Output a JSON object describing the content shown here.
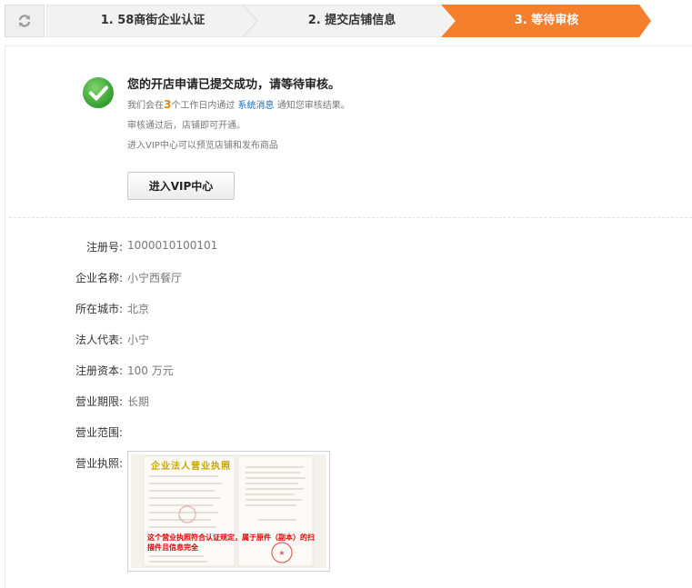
{
  "steps": [
    {
      "label": "1. 58商街企业认证",
      "active": false
    },
    {
      "label": "2. 提交店铺信息",
      "active": false
    },
    {
      "label": "3. 等待审核",
      "active": true
    }
  ],
  "colors": {
    "active_step": "#f47f2c",
    "inactive_step": "#f0f0f0",
    "success": "#3aa23a",
    "link": "#1a6db8",
    "highlight": "#f08300"
  },
  "success": {
    "title": "您的开店申请已提交成功，请等待审核。",
    "line1_prefix": "我们会在",
    "line1_days": "3",
    "line1_mid": "个工作日内通过",
    "line1_link": "系统消息",
    "line1_suffix": "通知您审核结果。",
    "line2": "审核通过后，店铺即可开通。",
    "line3": "进入VIP中心可以预览店铺和发布商品",
    "button": "进入VIP中心"
  },
  "info": {
    "reg_no_label": "注册号:",
    "reg_no": "1000010100101",
    "name_label": "企业名称:",
    "name": "小宁西餐厅",
    "city_label": "所在城市:",
    "city": "北京",
    "rep_label": "法人代表:",
    "rep": "小宁",
    "capital_label": "注册资本:",
    "capital": "100 万元",
    "period_label": "营业期限:",
    "period": "长期",
    "scope_label": "营业范围:",
    "scope": "",
    "license_label": "营业执照:"
  },
  "license_image": {
    "title": "企业法人营业执照",
    "warning": "这个营业执照符合认证规定，属于原件（副本）的扫描件且信息完全"
  }
}
